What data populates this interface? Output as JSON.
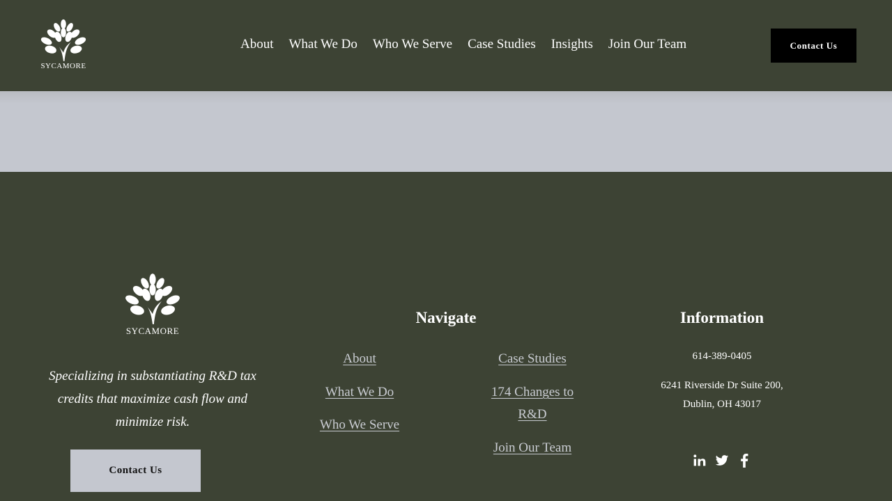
{
  "header": {
    "logo_text": "SYCAMORE",
    "nav": [
      "About",
      "What We Do",
      "Who We Serve",
      "Case Studies",
      "Insights",
      "Join Our Team"
    ],
    "contact_button": "Contact Us"
  },
  "footer": {
    "logo_text": "SYCAMORE",
    "tagline": "Specializing in substantiating R&D tax credits that maximize cash flow and minimize risk.",
    "contact_button": "Contact Us",
    "navigate_title": "Navigate",
    "navigate_col1": [
      "About",
      "What We Do",
      "Who We Serve"
    ],
    "navigate_col2": [
      "Case Studies",
      "174 Changes to R&D",
      "Join Our Team"
    ],
    "info_title": "Information",
    "phone": "614-389-0405",
    "address_line1": "6241 Riverside Dr Suite 200,",
    "address_line2": "Dublin, OH 43017",
    "social": [
      "linkedin-icon",
      "twitter-icon",
      "facebook-icon"
    ]
  },
  "colors": {
    "background": "#3d4334",
    "band": "#c4c7cf",
    "link": "#c9ccd2",
    "button_dark": "#000000"
  }
}
